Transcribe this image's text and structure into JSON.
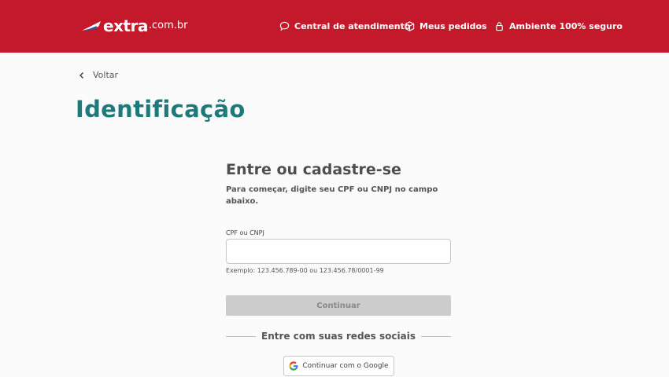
{
  "header": {
    "logo": {
      "name": "extra",
      "domain": ".com.br"
    },
    "nav": [
      {
        "label": "Central de atendimento",
        "icon": "chat-bubble-icon"
      },
      {
        "label": "Meus pedidos",
        "icon": "box-icon"
      },
      {
        "label": "Ambiente 100% seguro",
        "icon": "lock-icon"
      }
    ]
  },
  "back": {
    "label": "Voltar"
  },
  "page": {
    "title": "Identificação"
  },
  "form": {
    "title": "Entre ou cadastre-se",
    "subtitle": "Para começar, digite seu CPF ou CNPJ no campo abaixo.",
    "field_label": "CPF ou CNPJ",
    "field_value": "",
    "field_placeholder": "",
    "hint": "Exemplo: 123.456.789-00 ou 123.456.78/0001-99",
    "continue_label": "Continuar"
  },
  "social": {
    "divider_text": "Entre com suas redes sociais",
    "google_label": "Continuar com o Google"
  },
  "colors": {
    "header_bg": "#c3192b",
    "title": "#1e7a7a",
    "button_disabled": "#cccccc"
  }
}
